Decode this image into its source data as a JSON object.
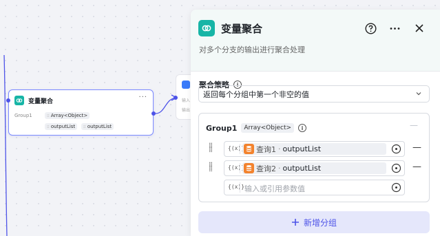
{
  "canvas": {
    "node": {
      "title": "变量聚合",
      "more": "···",
      "group_label": "Group1",
      "type_tag": "Array<Object>",
      "vars": [
        "outputList",
        "outputList"
      ]
    },
    "node2": {
      "line1": "输入",
      "line2": "输出"
    }
  },
  "panel": {
    "title": "变量聚合",
    "description": "对多个分支的输出进行聚合处理",
    "strategy_label": "聚合策略",
    "strategy_value": "返回每个分组中第一个非空的值",
    "group": {
      "name": "Group1",
      "type": "Array<Object>",
      "rows": [
        {
          "source": "查询1",
          "var": "outputList"
        },
        {
          "source": "查询2",
          "var": "outputList"
        }
      ],
      "input_placeholder": "输入或引用参数值"
    },
    "add_group_label": "新增分组"
  },
  "colors": {
    "accent": "#4d53e8",
    "node_icon": "#17b5a6",
    "db_icon": "#f3832e"
  }
}
